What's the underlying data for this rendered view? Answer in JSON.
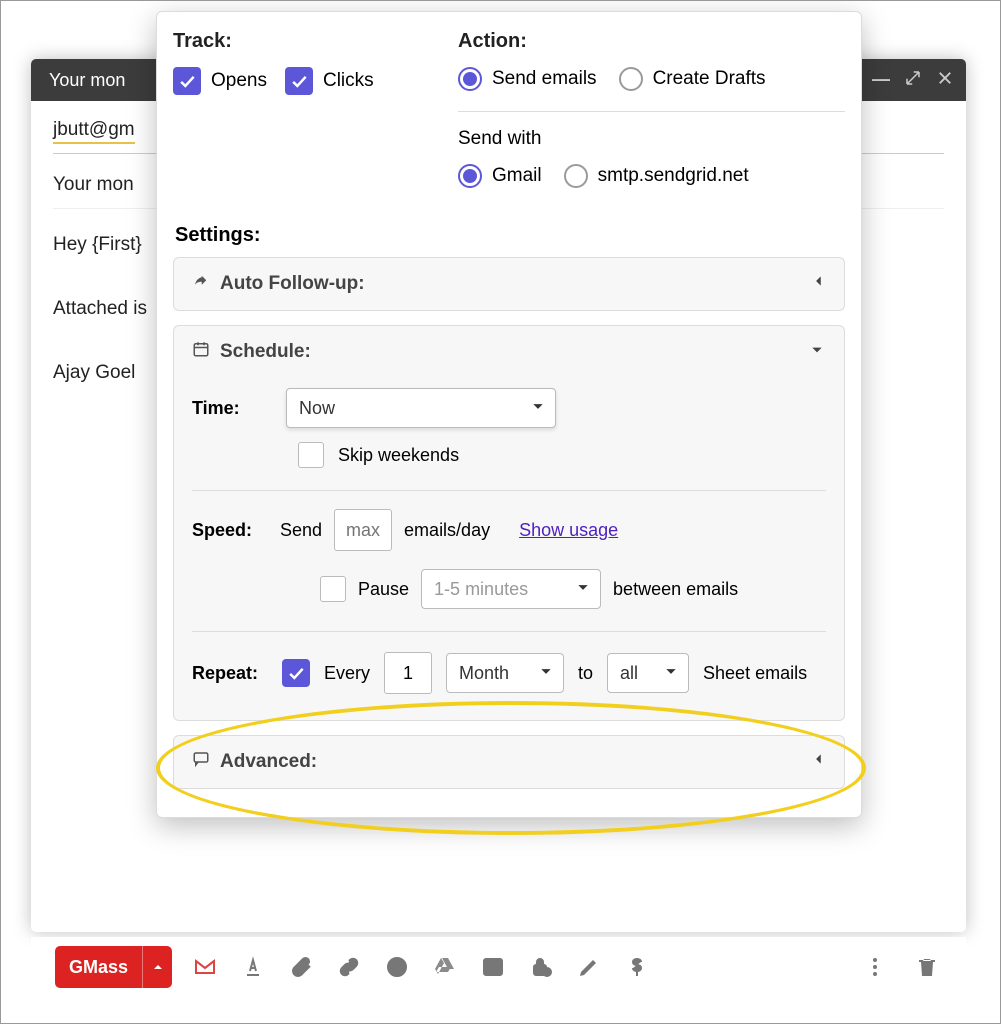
{
  "compose": {
    "title": "Your mon",
    "to": "jbutt@gm",
    "subject": "Your mon",
    "body_lines": [
      "Hey {First}",
      "Attached is",
      "Ajay Goel"
    ]
  },
  "gmass": {
    "track": {
      "label": "Track:",
      "opens": {
        "label": "Opens",
        "checked": true
      },
      "clicks": {
        "label": "Clicks",
        "checked": true
      }
    },
    "action": {
      "label": "Action:",
      "send_emails": {
        "label": "Send emails",
        "selected": true
      },
      "create_drafts": {
        "label": "Create Drafts",
        "selected": false
      }
    },
    "send_with": {
      "label": "Send with",
      "gmail": {
        "label": "Gmail",
        "selected": true
      },
      "smtp": {
        "label": "smtp.sendgrid.net",
        "selected": false
      }
    },
    "settings_label": "Settings:",
    "auto_followup": {
      "label": "Auto Follow-up:"
    },
    "schedule": {
      "label": "Schedule:",
      "time_label": "Time:",
      "time_value": "Now",
      "skip_weekends": {
        "label": "Skip weekends",
        "checked": false
      },
      "speed_label": "Speed:",
      "speed_send": "Send",
      "speed_max_placeholder": "max",
      "speed_unit": "emails/day",
      "show_usage": "Show usage",
      "pause": {
        "label": "Pause",
        "checked": false,
        "value": "1-5 minutes",
        "suffix": "between emails"
      },
      "repeat": {
        "label": "Repeat:",
        "checked": true,
        "every": "Every",
        "count": "1",
        "unit": "Month",
        "to": "to",
        "target": "all",
        "suffix": "Sheet emails"
      }
    },
    "advanced": {
      "label": "Advanced:"
    }
  },
  "toolbar": {
    "gmass": "GMass"
  }
}
